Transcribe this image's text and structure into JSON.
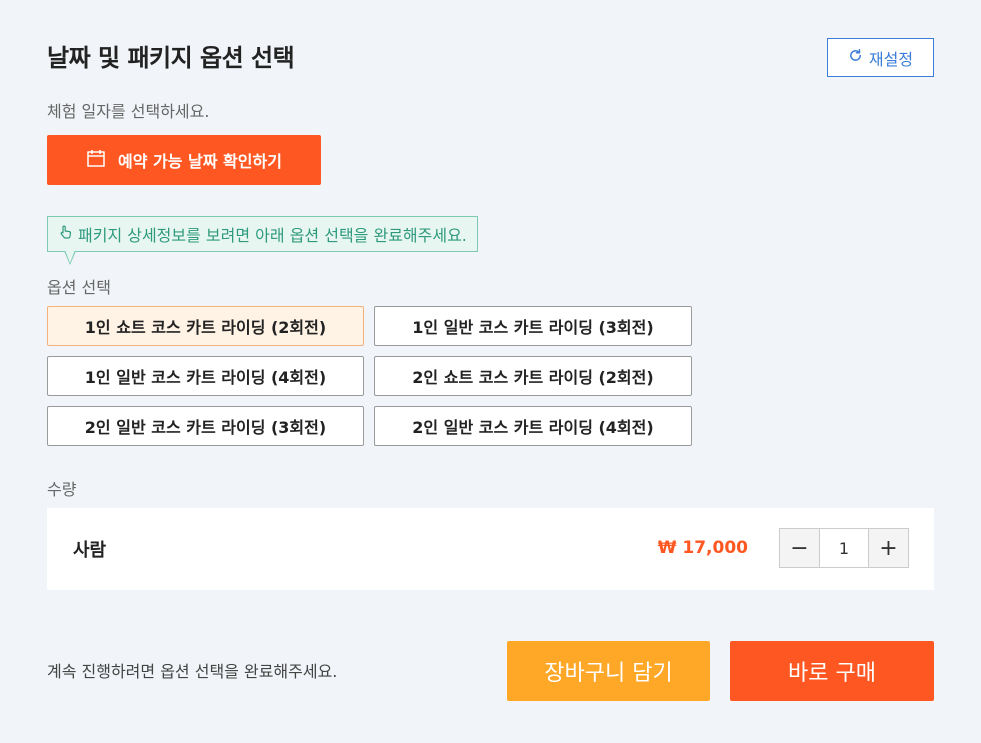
{
  "header": {
    "title": "날짜 및 패키지 옵션 선택",
    "reset_label": "재설정",
    "reset_icon": "refresh-icon"
  },
  "date": {
    "subtitle": "체험 일자를 선택하세요.",
    "button_label": "예약 가능 날짜 확인하기",
    "button_icon": "calendar-icon"
  },
  "tooltip": {
    "icon": "hand-pointer-icon",
    "text": "패키지 상세정보를 보려면 아래 옵션 선택을 완료해주세요."
  },
  "options": {
    "label": "옵션 선택",
    "items": [
      {
        "label": "1인 쇼트 코스 카트 라이딩 (2회전)",
        "selected": true
      },
      {
        "label": "1인 일반 코스 카트 라이딩 (3회전)",
        "selected": false
      },
      {
        "label": "1인 일반 코스 카트 라이딩 (4회전)",
        "selected": false
      },
      {
        "label": "2인 쇼트 코스 카트 라이딩 (2회전)",
        "selected": false
      },
      {
        "label": "2인 일반 코스 카트 라이딩 (3회전)",
        "selected": false
      },
      {
        "label": "2인 일반 코스 카트 라이딩 (4회전)",
        "selected": false
      }
    ]
  },
  "quantity": {
    "label": "수량",
    "item_name": "사람",
    "price": "₩ 17,000",
    "value": "1",
    "minus_label": "−",
    "plus_label": "+"
  },
  "footer": {
    "message": "계속 진행하려면 옵션 선택을 완료해주세요.",
    "cart_label": "장바구니 담기",
    "buy_label": "바로 구매"
  },
  "colors": {
    "primary": "#ff5722",
    "secondary": "#ffa726",
    "accent_blue": "#3b7dd8",
    "tooltip_green": "#2e9a7c"
  }
}
